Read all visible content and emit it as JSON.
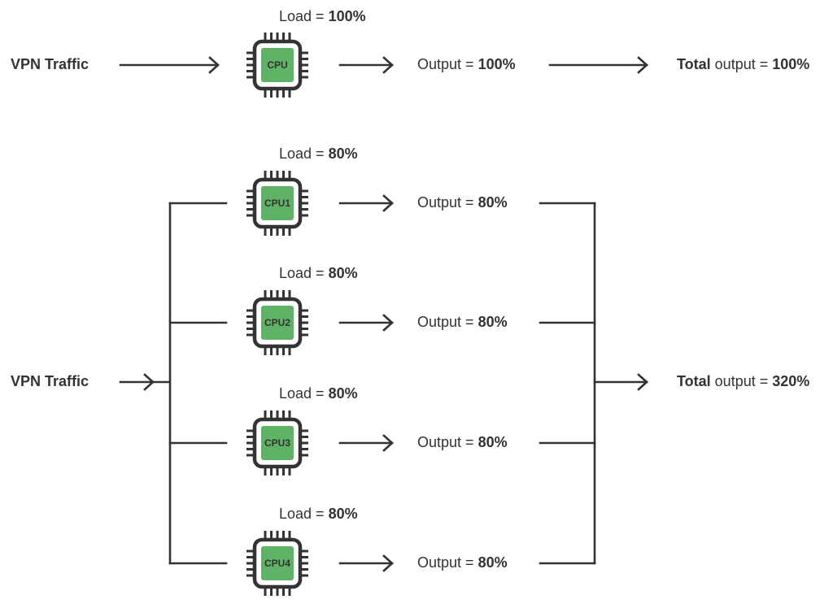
{
  "colors": {
    "chip_fill": "#5fb266",
    "stroke": "#333333"
  },
  "single": {
    "source": "VPN Traffic",
    "cpu": {
      "name": "CPU",
      "load_label": "Load = ",
      "load": "100%",
      "output_label": "Output = ",
      "output": "100%"
    },
    "total_bold": "Total",
    "total_label": " output = ",
    "total": "100%"
  },
  "multi": {
    "source": "VPN Traffic",
    "cpus": [
      {
        "name": "CPU1",
        "load_label": "Load = ",
        "load": "80%",
        "output_label": "Output = ",
        "output": "80%"
      },
      {
        "name": "CPU2",
        "load_label": "Load = ",
        "load": "80%",
        "output_label": "Output = ",
        "output": "80%"
      },
      {
        "name": "CPU3",
        "load_label": "Load = ",
        "load": "80%",
        "output_label": "Output = ",
        "output": "80%"
      },
      {
        "name": "CPU4",
        "load_label": "Load = ",
        "load": "80%",
        "output_label": "Output = ",
        "output": "80%"
      }
    ],
    "total_bold": "Total",
    "total_label": " output = ",
    "total": "320%"
  }
}
